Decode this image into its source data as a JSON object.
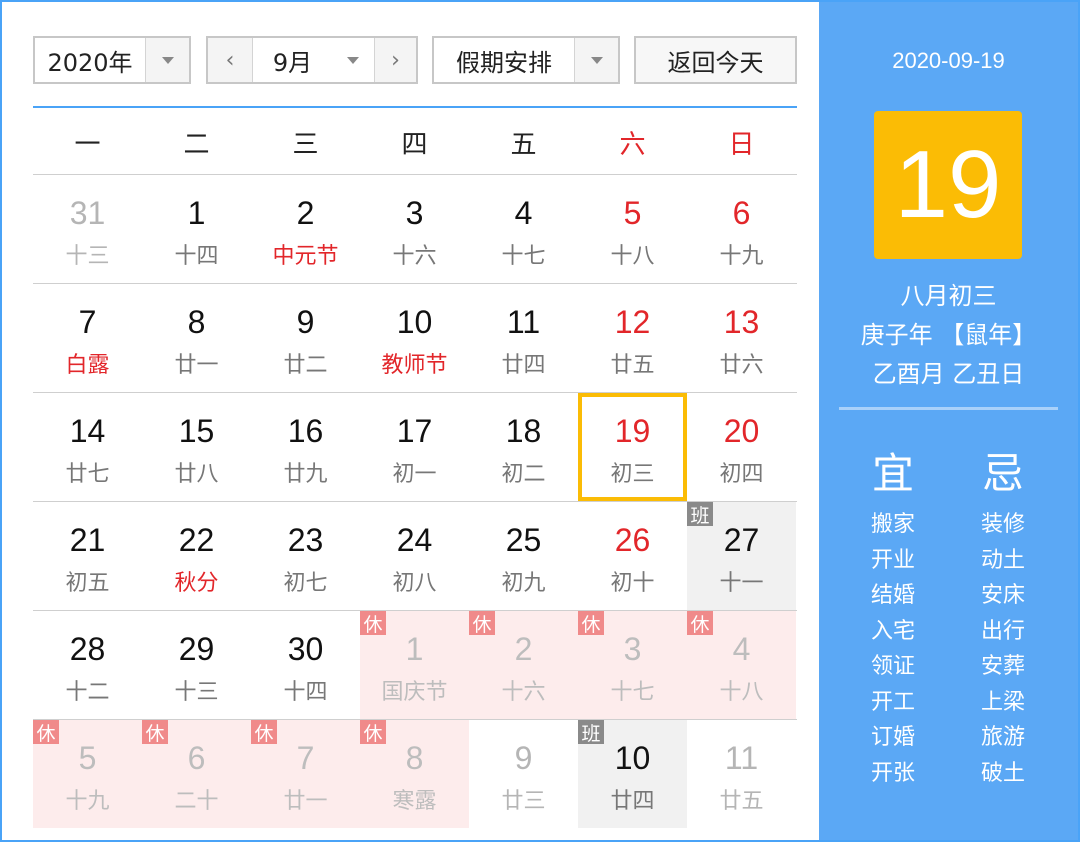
{
  "toolbar": {
    "year": "2020年",
    "month": "9月",
    "holiday_select": "假期安排",
    "today_button": "返回今天"
  },
  "weekdays": [
    "一",
    "二",
    "三",
    "四",
    "五",
    "六",
    "日"
  ],
  "weeks": [
    [
      {
        "day": "31",
        "lunar": "十三",
        "state": "other"
      },
      {
        "day": "1",
        "lunar": "十四"
      },
      {
        "day": "2",
        "lunar": "中元节",
        "festival": true
      },
      {
        "day": "3",
        "lunar": "十六"
      },
      {
        "day": "4",
        "lunar": "十七"
      },
      {
        "day": "5",
        "lunar": "十八",
        "weekend": true
      },
      {
        "day": "6",
        "lunar": "十九",
        "weekend": true
      }
    ],
    [
      {
        "day": "7",
        "lunar": "白露",
        "festival": true
      },
      {
        "day": "8",
        "lunar": "廿一"
      },
      {
        "day": "9",
        "lunar": "廿二"
      },
      {
        "day": "10",
        "lunar": "教师节",
        "festival": true
      },
      {
        "day": "11",
        "lunar": "廿四"
      },
      {
        "day": "12",
        "lunar": "廿五",
        "weekend": true
      },
      {
        "day": "13",
        "lunar": "廿六",
        "weekend": true
      }
    ],
    [
      {
        "day": "14",
        "lunar": "廿七"
      },
      {
        "day": "15",
        "lunar": "廿八"
      },
      {
        "day": "16",
        "lunar": "廿九"
      },
      {
        "day": "17",
        "lunar": "初一"
      },
      {
        "day": "18",
        "lunar": "初二"
      },
      {
        "day": "19",
        "lunar": "初三",
        "weekend": true,
        "today": true
      },
      {
        "day": "20",
        "lunar": "初四",
        "weekend": true
      }
    ],
    [
      {
        "day": "21",
        "lunar": "初五"
      },
      {
        "day": "22",
        "lunar": "秋分",
        "festival": true
      },
      {
        "day": "23",
        "lunar": "初七"
      },
      {
        "day": "24",
        "lunar": "初八"
      },
      {
        "day": "25",
        "lunar": "初九"
      },
      {
        "day": "26",
        "lunar": "初十",
        "weekend": true
      },
      {
        "day": "27",
        "lunar": "十一",
        "badge": "班",
        "badge_type": "work"
      }
    ],
    [
      {
        "day": "28",
        "lunar": "十二"
      },
      {
        "day": "29",
        "lunar": "十三"
      },
      {
        "day": "30",
        "lunar": "十四"
      },
      {
        "day": "1",
        "lunar": "国庆节",
        "badge": "休",
        "badge_type": "rest"
      },
      {
        "day": "2",
        "lunar": "十六",
        "badge": "休",
        "badge_type": "rest"
      },
      {
        "day": "3",
        "lunar": "十七",
        "badge": "休",
        "badge_type": "rest"
      },
      {
        "day": "4",
        "lunar": "十八",
        "badge": "休",
        "badge_type": "rest"
      }
    ],
    [
      {
        "day": "5",
        "lunar": "十九",
        "badge": "休",
        "badge_type": "rest"
      },
      {
        "day": "6",
        "lunar": "二十",
        "badge": "休",
        "badge_type": "rest"
      },
      {
        "day": "7",
        "lunar": "廿一",
        "badge": "休",
        "badge_type": "rest"
      },
      {
        "day": "8",
        "lunar": "寒露",
        "badge": "休",
        "badge_type": "rest"
      },
      {
        "day": "9",
        "lunar": "廿三",
        "state": "other"
      },
      {
        "day": "10",
        "lunar": "廿四",
        "badge": "班",
        "badge_type": "work"
      },
      {
        "day": "11",
        "lunar": "廿五",
        "state": "other"
      }
    ]
  ],
  "panel": {
    "date": "2020-09-19",
    "big_day": "19",
    "lunar_date": "八月初三",
    "year_ganzhi": "庚子年 【鼠年】",
    "month_day_ganzhi": "乙酉月 乙丑日",
    "yi_label": "宜",
    "ji_label": "忌",
    "yi": [
      "搬家",
      "开业",
      "结婚",
      "入宅",
      "领证",
      "开工",
      "订婚",
      "开张"
    ],
    "ji": [
      "装修",
      "动土",
      "安床",
      "出行",
      "安葬",
      "上梁",
      "旅游",
      "破土"
    ]
  },
  "colors": {
    "accent": "#4aa3f7",
    "panel": "#5ba8f5",
    "today": "#fbbc05",
    "holiday_red": "#e2262a"
  }
}
